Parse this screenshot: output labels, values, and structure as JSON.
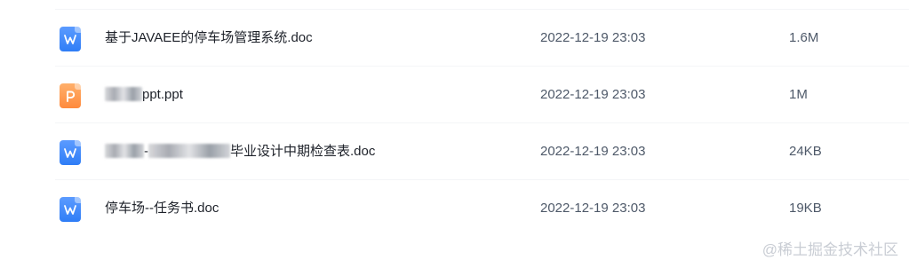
{
  "files": [
    {
      "icon": "word-doc-icon",
      "name_prefix": "",
      "name_suffix": "基于JAVAEE的停车场管理系统.doc",
      "modified": "2022-12-19 23:03",
      "size": "1.6M",
      "redacted": false
    },
    {
      "icon": "powerpoint-icon",
      "name_prefix": "",
      "name_suffix": "ppt.ppt",
      "modified": "2022-12-19 23:03",
      "size": "1M",
      "redacted": true
    },
    {
      "icon": "word-doc-icon",
      "name_prefix": "-",
      "name_suffix": "毕业设计中期检查表.doc",
      "modified": "2022-12-19 23:03",
      "size": "24KB",
      "redacted": true
    },
    {
      "icon": "word-doc-icon",
      "name_prefix": "",
      "name_suffix": "停车场--任务书.doc",
      "modified": "2022-12-19 23:03",
      "size": "19KB",
      "redacted": false
    }
  ],
  "watermark": "@稀土掘金技术社区",
  "colors": {
    "doc_icon": "#2f7df6",
    "ppt_icon": "#ff8a3d",
    "text": "#1d2129",
    "meta": "#4e5969"
  }
}
